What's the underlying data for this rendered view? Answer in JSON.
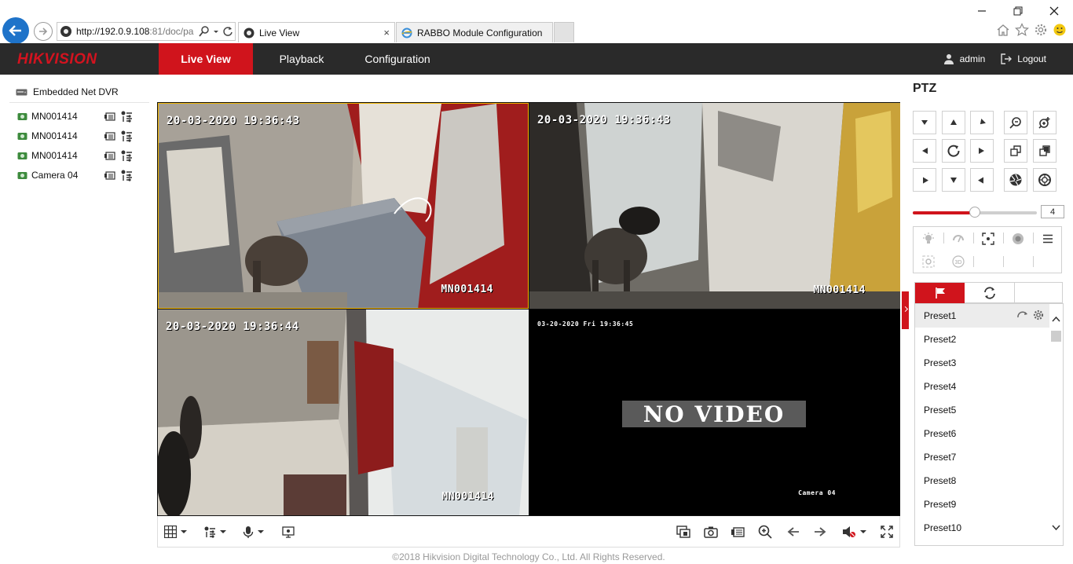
{
  "browser": {
    "url_host": "http://192.0.9.108",
    "url_rest": ":81/doc/pa",
    "tabs": [
      {
        "label": "Live View"
      },
      {
        "label": "RABBO Module Configuration"
      }
    ],
    "tab_close": "×"
  },
  "app": {
    "logo": "HIKVISION",
    "nav": {
      "live": "Live View",
      "playback": "Playback",
      "configuration": "Configuration"
    },
    "user": "admin",
    "logout": "Logout"
  },
  "tree": {
    "root": "Embedded Net DVR",
    "items": [
      {
        "label": "MN001414"
      },
      {
        "label": "MN001414"
      },
      {
        "label": "MN001414"
      },
      {
        "label": "Camera 04"
      }
    ]
  },
  "video": {
    "tiles": [
      {
        "time": "20-03-2020 19:36:43",
        "name": "MN001414"
      },
      {
        "time": "20-03-2020 19:36:43",
        "name": "MN001414"
      },
      {
        "time": "20-03-2020 19:36:44",
        "name": "MN001414"
      },
      {
        "time": "03-20-2020 Fri 19:36:45",
        "name": "Camera 04",
        "overlay": "NO VIDEO"
      }
    ]
  },
  "footer": "©2018 Hikvision Digital Technology Co., Ltd. All Rights Reserved.",
  "ptz": {
    "title": "PTZ",
    "speed": "4",
    "speed_level": 0.5,
    "presets": [
      "Preset1",
      "Preset2",
      "Preset3",
      "Preset4",
      "Preset5",
      "Preset6",
      "Preset7",
      "Preset8",
      "Preset9",
      "Preset10"
    ]
  },
  "colors": {
    "brand_red": "#d0141c",
    "header_bg": "#2a2a2a",
    "selected_border": "#f0b400"
  }
}
